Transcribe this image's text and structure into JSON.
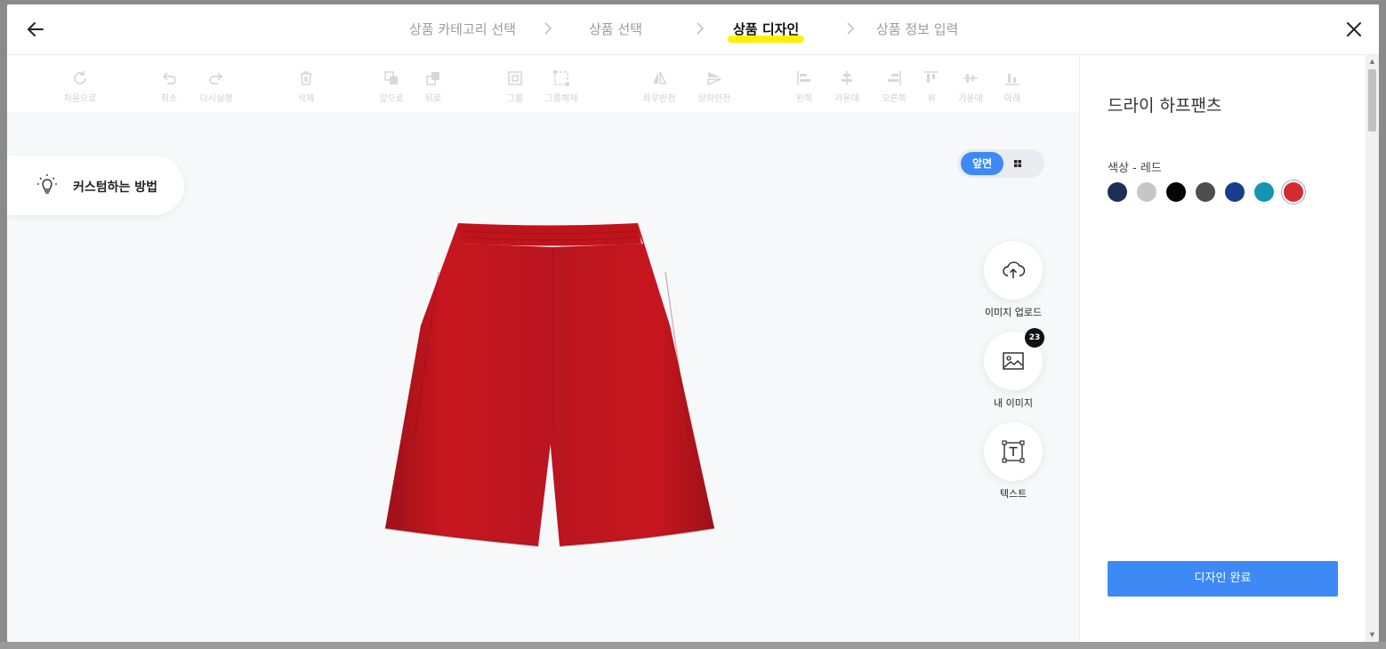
{
  "steps": [
    {
      "label": "상품 카테고리 선택"
    },
    {
      "label": "상품 선택"
    },
    {
      "label": "상품 디자인"
    },
    {
      "label": "상품 정보 입력"
    }
  ],
  "toolbar": {
    "reset": "처음으로",
    "undo": "취소",
    "redo": "다시실행",
    "delete": "삭제",
    "forward": "앞으로",
    "backward": "뒤로",
    "group": "그룹",
    "ungroup": "그룹해제",
    "flip_h": "좌우반전",
    "flip_v": "상하반전",
    "align_left": "왼쪽",
    "align_center_h": "가운데",
    "align_right": "오른쪽",
    "align_top": "위",
    "align_center_v": "가운데",
    "align_bottom": "아래"
  },
  "howto": {
    "label": "커스텀하는 방법"
  },
  "view": {
    "front": "앞면"
  },
  "side_tools": {
    "upload": "이미지 업로드",
    "my_images": "내 이미지",
    "my_images_count": "23",
    "text": "텍스트"
  },
  "product": {
    "title": "드라이 하프팬츠",
    "color_label": "색상 - 레드",
    "colors": [
      "#1c2f57",
      "#c6c6c6",
      "#050505",
      "#4e4e52",
      "#163e8c",
      "#1594b4",
      "#d22b30"
    ],
    "selected_color_index": 6,
    "done_label": "디자인 완료"
  }
}
